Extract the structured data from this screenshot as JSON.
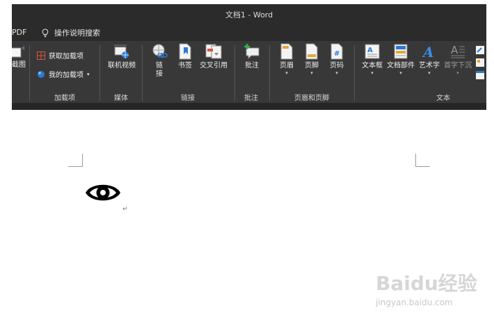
{
  "window": {
    "title": "文档1  -  Word"
  },
  "menubar": {
    "pdf_tab": "PDF",
    "tell_me": "操作说明搜索"
  },
  "ribbon": {
    "screenshot_label": "截图",
    "groups": {
      "addins": {
        "label": "加载项",
        "get_addins": "获取加载项",
        "my_addins": "我的加载项"
      },
      "media": {
        "label": "媒体",
        "online_video": "联机视频"
      },
      "links": {
        "label": "链接",
        "link_line1": "链",
        "link_line2": "接",
        "bookmark": "书签",
        "cross_ref": "交叉引用"
      },
      "comments": {
        "label": "批注",
        "comment": "批注"
      },
      "header_footer": {
        "label": "页眉和页脚",
        "header": "页眉",
        "footer": "页脚",
        "page_number": "页码"
      },
      "text": {
        "label": "文本",
        "textbox": "文本框",
        "quick_parts": "文档部件",
        "wordart": "艺术字",
        "drop_cap": "首字下沉"
      }
    }
  },
  "document": {
    "paragraph_mark": "↵"
  },
  "watermark": {
    "brand": "Baidu经验",
    "url": "jingyan.baidu.com"
  },
  "colors": {
    "titlebar": "#2b2b2b",
    "ribbon": "#383838",
    "word_blue": "#2b79d3",
    "addin_red": "#d9573b"
  }
}
